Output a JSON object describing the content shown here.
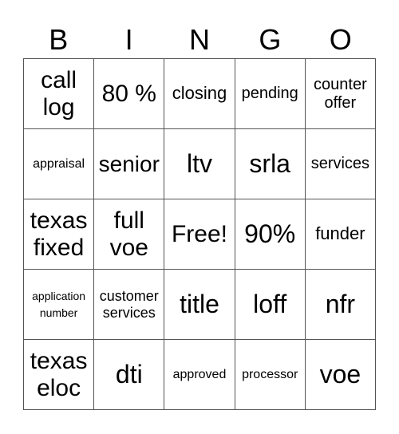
{
  "header": [
    "B",
    "I",
    "N",
    "G",
    "O"
  ],
  "board": [
    [
      {
        "text": "call log",
        "size": "s30"
      },
      {
        "text": "80 %",
        "size": "s30"
      },
      {
        "text": "closing",
        "size": "s22"
      },
      {
        "text": "pending",
        "size": "s20"
      },
      {
        "text": "counter offer",
        "size": "s20"
      }
    ],
    [
      {
        "text": "appraisal",
        "size": "s16"
      },
      {
        "text": "senior",
        "size": "s28"
      },
      {
        "text": "ltv",
        "size": "s34"
      },
      {
        "text": "srla",
        "size": "s34"
      },
      {
        "text": "services",
        "size": "s20"
      }
    ],
    [
      {
        "text": "texas fixed",
        "size": "s30"
      },
      {
        "text": "full voe",
        "size": "s30"
      },
      {
        "text": "Free!",
        "size": "s30"
      },
      {
        "text": "90%",
        "size": "s34"
      },
      {
        "text": "funder",
        "size": "s22"
      }
    ],
    [
      {
        "text": "application number",
        "size": "s14"
      },
      {
        "text": "customer services",
        "size": "s18"
      },
      {
        "text": "title",
        "size": "s34"
      },
      {
        "text": "loff",
        "size": "s34"
      },
      {
        "text": "nfr",
        "size": "s34"
      }
    ],
    [
      {
        "text": "texas eloc",
        "size": "s30"
      },
      {
        "text": "dti",
        "size": "s34"
      },
      {
        "text": "approved",
        "size": "s16"
      },
      {
        "text": "processor",
        "size": "s16"
      },
      {
        "text": "voe",
        "size": "s34"
      }
    ]
  ]
}
